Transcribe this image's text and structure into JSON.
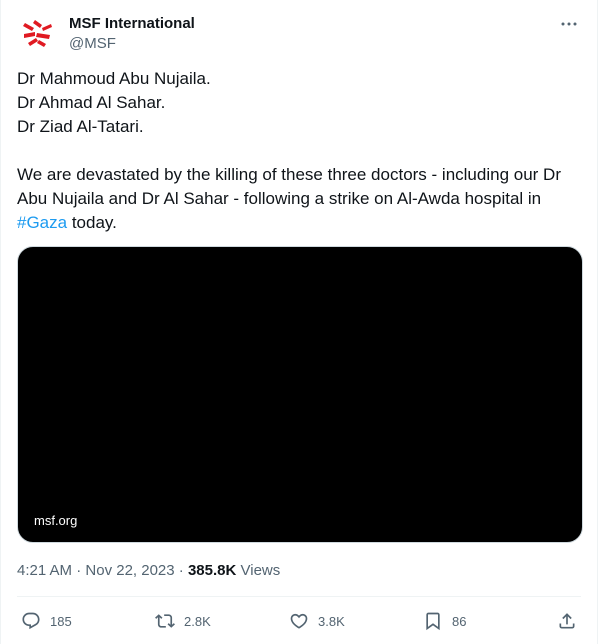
{
  "author": {
    "display_name": "MSF International",
    "handle": "@MSF",
    "avatar_icon": "msf-logo-icon",
    "brand_color": "#e01a22"
  },
  "tweet": {
    "lines": [
      "Dr Mahmoud Abu Nujaila.",
      "Dr Ahmad Al Sahar.",
      "Dr Ziad Al-Tatari."
    ],
    "paragraph_line1": "We are devastated by the killing of these three doctors - including our Dr",
    "paragraph_line2": "Abu Nujaila and Dr Al Sahar - following a strike on Al-Awda hospital in",
    "hashtag": "#Gaza",
    "paragraph_tail": " today.",
    "hashtag_color": "#1d9bf0"
  },
  "media": {
    "source": "msf.org"
  },
  "meta": {
    "time": "4:21 AM",
    "separator": " · ",
    "date": "Nov 22, 2023",
    "separator2": " · ",
    "views": "385.8K",
    "views_label": " Views"
  },
  "actions": {
    "reply_count": "185",
    "retweet_count": "2.8K",
    "like_count": "3.8K",
    "bookmark_count": "86",
    "icons": [
      "reply-icon",
      "retweet-icon",
      "like-icon",
      "bookmark-icon",
      "share-icon"
    ]
  }
}
